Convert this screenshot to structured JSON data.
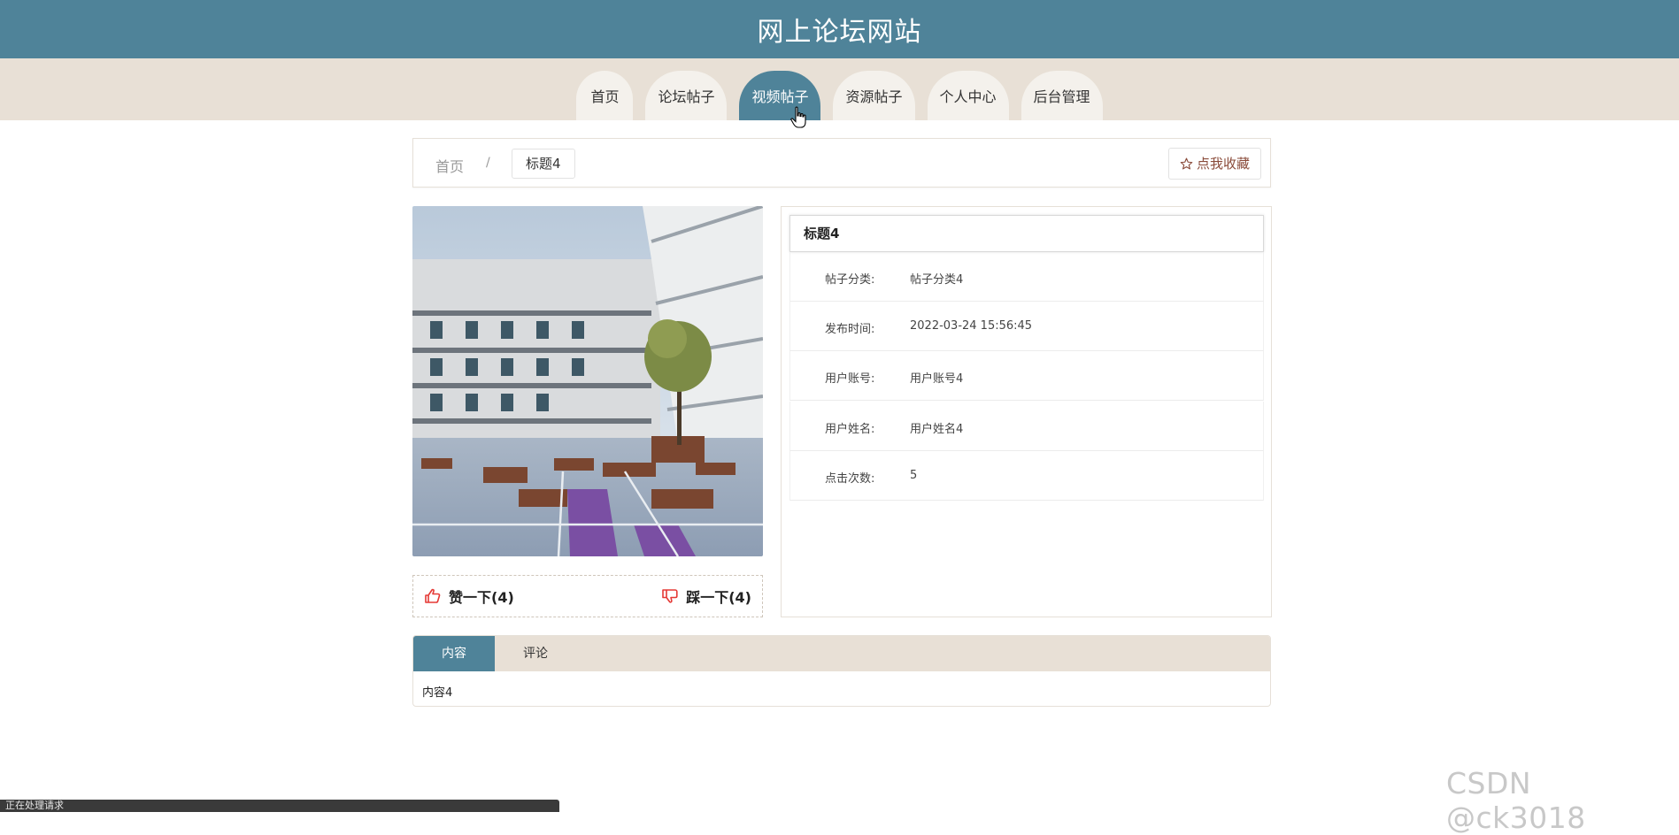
{
  "site": {
    "title": "网上论坛网站"
  },
  "nav": {
    "items": [
      {
        "label": "首页"
      },
      {
        "label": "论坛帖子"
      },
      {
        "label": "视频帖子",
        "active": true
      },
      {
        "label": "资源帖子"
      },
      {
        "label": "个人中心"
      },
      {
        "label": "后台管理"
      }
    ]
  },
  "breadcrumb": {
    "home": "首页",
    "separator": "/",
    "current": "标题4"
  },
  "favorite": {
    "label": "点我收藏",
    "icon": "star-icon"
  },
  "post": {
    "title": "标题4",
    "fields": [
      {
        "label": "帖子分类:",
        "value": "帖子分类4"
      },
      {
        "label": "发布时间:",
        "value": "2022-03-24 15:56:45"
      },
      {
        "label": "用户账号:",
        "value": "用户账号4"
      },
      {
        "label": "用户姓名:",
        "value": "用户姓名4"
      },
      {
        "label": "点击次数:",
        "value": "5"
      }
    ]
  },
  "votes": {
    "like": {
      "label": "赞一下(4)",
      "icon": "thumbs-up-icon"
    },
    "dislike": {
      "label": "踩一下(4)",
      "icon": "thumbs-down-icon"
    }
  },
  "tabs": {
    "items": [
      {
        "label": "内容",
        "active": true
      },
      {
        "label": "评论"
      }
    ],
    "content": "内容4"
  },
  "watermark": "CSDN @ck3018",
  "status_bar": "正在处理请求",
  "colors": {
    "primary": "#4f8399",
    "nav_bg": "#e8e0d6",
    "accent_red": "#e53935"
  }
}
